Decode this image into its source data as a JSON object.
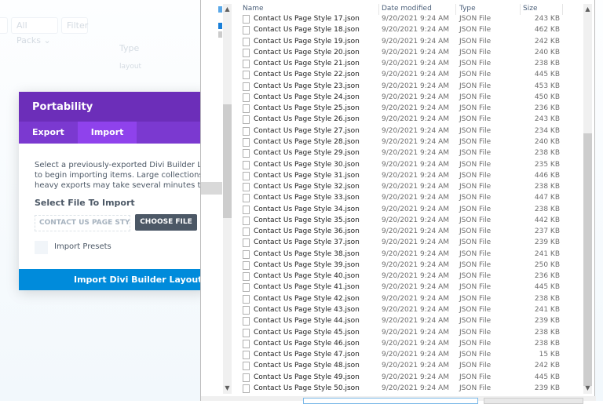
{
  "background": {
    "packs_dropdown": "All Packs",
    "filter_button": "Filter",
    "type_header": "Type",
    "type_value": "layout"
  },
  "portability": {
    "title": "Portability",
    "tabs": [
      {
        "label": "Export",
        "active": false
      },
      {
        "label": "Import",
        "active": true
      }
    ],
    "description_lines": [
      "Select a previously-exported Divi Builder Layouts",
      "to begin importing items. Large collections of ima",
      "heavy exports may take several minutes to uploa"
    ],
    "select_file_label": "Select File To Import",
    "file_input_value": "CONTACT US PAGE STYLE ...",
    "choose_file_button": "CHOOSE FILE",
    "import_presets_label": "Import Presets",
    "import_button": "Import Divi Builder Layouts",
    "colors": {
      "header": "#6c2eb9",
      "active_tab": "#8f42ec",
      "button": "#008bdb"
    }
  },
  "file_dialog": {
    "columns": {
      "name": "Name",
      "date": "Date modified",
      "type": "Type",
      "size": "Size"
    },
    "files": [
      {
        "name": "Contact Us Page Style 17.json",
        "date": "9/20/2021 9:24 AM",
        "type": "JSON File",
        "size": "243 KB"
      },
      {
        "name": "Contact Us Page Style 18.json",
        "date": "9/20/2021 9:24 AM",
        "type": "JSON File",
        "size": "462 KB"
      },
      {
        "name": "Contact Us Page Style 19.json",
        "date": "9/20/2021 9:24 AM",
        "type": "JSON File",
        "size": "242 KB"
      },
      {
        "name": "Contact Us Page Style 20.json",
        "date": "9/20/2021 9:24 AM",
        "type": "JSON File",
        "size": "240 KB"
      },
      {
        "name": "Contact Us Page Style 21.json",
        "date": "9/20/2021 9:24 AM",
        "type": "JSON File",
        "size": "238 KB"
      },
      {
        "name": "Contact Us Page Style 22.json",
        "date": "9/20/2021 9:24 AM",
        "type": "JSON File",
        "size": "445 KB"
      },
      {
        "name": "Contact Us Page Style 23.json",
        "date": "9/20/2021 9:24 AM",
        "type": "JSON File",
        "size": "453 KB"
      },
      {
        "name": "Contact Us Page Style 24.json",
        "date": "9/20/2021 9:24 AM",
        "type": "JSON File",
        "size": "450 KB"
      },
      {
        "name": "Contact Us Page Style 25.json",
        "date": "9/20/2021 9:24 AM",
        "type": "JSON File",
        "size": "236 KB"
      },
      {
        "name": "Contact Us Page Style 26.json",
        "date": "9/20/2021 9:24 AM",
        "type": "JSON File",
        "size": "243 KB"
      },
      {
        "name": "Contact Us Page Style 27.json",
        "date": "9/20/2021 9:24 AM",
        "type": "JSON File",
        "size": "234 KB"
      },
      {
        "name": "Contact Us Page Style 28.json",
        "date": "9/20/2021 9:24 AM",
        "type": "JSON File",
        "size": "240 KB"
      },
      {
        "name": "Contact Us Page Style 29.json",
        "date": "9/20/2021 9:24 AM",
        "type": "JSON File",
        "size": "238 KB"
      },
      {
        "name": "Contact Us Page Style 30.json",
        "date": "9/20/2021 9:24 AM",
        "type": "JSON File",
        "size": "235 KB"
      },
      {
        "name": "Contact Us Page Style 31.json",
        "date": "9/20/2021 9:24 AM",
        "type": "JSON File",
        "size": "446 KB"
      },
      {
        "name": "Contact Us Page Style 32.json",
        "date": "9/20/2021 9:24 AM",
        "type": "JSON File",
        "size": "238 KB"
      },
      {
        "name": "Contact Us Page Style 33.json",
        "date": "9/20/2021 9:24 AM",
        "type": "JSON File",
        "size": "447 KB"
      },
      {
        "name": "Contact Us Page Style 34.json",
        "date": "9/20/2021 9:24 AM",
        "type": "JSON File",
        "size": "238 KB"
      },
      {
        "name": "Contact Us Page Style 35.json",
        "date": "9/20/2021 9:24 AM",
        "type": "JSON File",
        "size": "442 KB"
      },
      {
        "name": "Contact Us Page Style 36.json",
        "date": "9/20/2021 9:24 AM",
        "type": "JSON File",
        "size": "237 KB"
      },
      {
        "name": "Contact Us Page Style 37.json",
        "date": "9/20/2021 9:24 AM",
        "type": "JSON File",
        "size": "239 KB"
      },
      {
        "name": "Contact Us Page Style 38.json",
        "date": "9/20/2021 9:24 AM",
        "type": "JSON File",
        "size": "241 KB"
      },
      {
        "name": "Contact Us Page Style 39.json",
        "date": "9/20/2021 9:24 AM",
        "type": "JSON File",
        "size": "250 KB"
      },
      {
        "name": "Contact Us Page Style 40.json",
        "date": "9/20/2021 9:24 AM",
        "type": "JSON File",
        "size": "236 KB"
      },
      {
        "name": "Contact Us Page Style 41.json",
        "date": "9/20/2021 9:24 AM",
        "type": "JSON File",
        "size": "445 KB"
      },
      {
        "name": "Contact Us Page Style 42.json",
        "date": "9/20/2021 9:24 AM",
        "type": "JSON File",
        "size": "238 KB"
      },
      {
        "name": "Contact Us Page Style 43.json",
        "date": "9/20/2021 9:24 AM",
        "type": "JSON File",
        "size": "241 KB"
      },
      {
        "name": "Contact Us Page Style 44.json",
        "date": "9/20/2021 9:24 AM",
        "type": "JSON File",
        "size": "239 KB"
      },
      {
        "name": "Contact Us Page Style 45.json",
        "date": "9/20/2021 9:24 AM",
        "type": "JSON File",
        "size": "238 KB"
      },
      {
        "name": "Contact Us Page Style 46.json",
        "date": "9/20/2021 9:24 AM",
        "type": "JSON File",
        "size": "238 KB"
      },
      {
        "name": "Contact Us Page Style 47.json",
        "date": "9/20/2021 9:24 AM",
        "type": "JSON File",
        "size": "15 KB"
      },
      {
        "name": "Contact Us Page Style 48.json",
        "date": "9/20/2021 9:24 AM",
        "type": "JSON File",
        "size": "242 KB"
      },
      {
        "name": "Contact Us Page Style 49.json",
        "date": "9/20/2021 9:24 AM",
        "type": "JSON File",
        "size": "445 KB"
      },
      {
        "name": "Contact Us Page Style 50.json",
        "date": "9/20/2021 9:24 AM",
        "type": "JSON File",
        "size": "239 KB"
      }
    ]
  }
}
